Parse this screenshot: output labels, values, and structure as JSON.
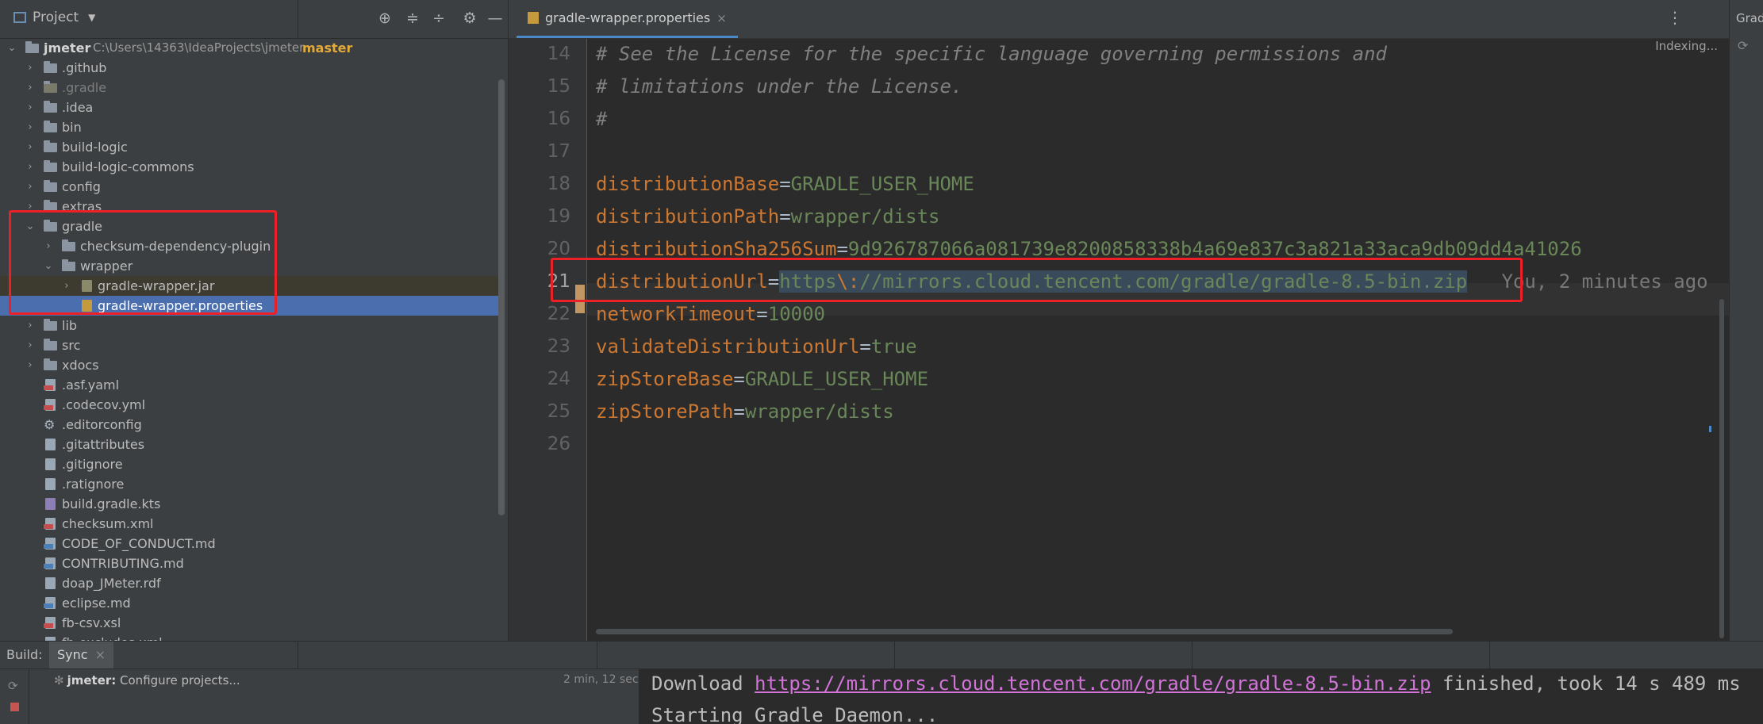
{
  "project_header": {
    "title": "Project"
  },
  "tree": {
    "root": {
      "name": "jmeter",
      "path": "C:\\Users\\14363\\IdeaProjects\\jmeter",
      "branch": "master"
    },
    "items": [
      {
        "label": ".github"
      },
      {
        "label": ".gradle"
      },
      {
        "label": ".idea"
      },
      {
        "label": "bin"
      },
      {
        "label": "build-logic"
      },
      {
        "label": "build-logic-commons"
      },
      {
        "label": "config"
      },
      {
        "label": "extras"
      },
      {
        "label": "gradle"
      },
      {
        "label": "checksum-dependency-plugin"
      },
      {
        "label": "wrapper"
      },
      {
        "label": "gradle-wrapper.jar"
      },
      {
        "label": "gradle-wrapper.properties"
      },
      {
        "label": "lib"
      },
      {
        "label": "src"
      },
      {
        "label": "xdocs"
      },
      {
        "label": ".asf.yaml"
      },
      {
        "label": ".codecov.yml"
      },
      {
        "label": ".editorconfig"
      },
      {
        "label": ".gitattributes"
      },
      {
        "label": ".gitignore"
      },
      {
        "label": ".ratignore"
      },
      {
        "label": "build.gradle.kts"
      },
      {
        "label": "checksum.xml"
      },
      {
        "label": "CODE_OF_CONDUCT.md"
      },
      {
        "label": "CONTRIBUTING.md"
      },
      {
        "label": "doap_JMeter.rdf"
      },
      {
        "label": "eclipse.md"
      },
      {
        "label": "fb-csv.xsl"
      },
      {
        "label": "fb-excludes.xml"
      }
    ]
  },
  "editor": {
    "tab_label": "gradle-wrapper.properties",
    "tab_close": "×",
    "status": "Indexing...",
    "line_numbers": [
      "14",
      "15",
      "16",
      "17",
      "18",
      "19",
      "20",
      "21",
      "22",
      "23",
      "24",
      "25",
      "26"
    ],
    "lines": {
      "l14": "# See the License for the specific language governing permissions and",
      "l15": "# limitations under the License.",
      "l16": "#",
      "l18_key": "distributionBase",
      "l18_val": "GRADLE_USER_HOME",
      "l19_key": "distributionPath",
      "l19_val": "wrapper/dists",
      "l20_key": "distributionSha256Sum",
      "l20_val": "9d926787066a081739e8200858338b4a69e837c3a821a33aca9db09dd4a41026",
      "l21_key": "distributionUrl",
      "l21_scheme": "https",
      "l21_escape": "\\:",
      "l21_rest": "//mirrors.cloud.tencent.com/gradle/gradle-8.5-bin.zip",
      "l21_blame": "You, 2 minutes ago",
      "l22_key": "networkTimeout",
      "l22_val": "10000",
      "l23_key": "validateDistributionUrl",
      "l23_val": "true",
      "l24_key": "zipStoreBase",
      "l24_val": "GRADLE_USER_HOME",
      "l25_key": "zipStorePath",
      "l25_val": "wrapper/dists"
    }
  },
  "right_strip": {
    "label": "Gradle"
  },
  "build": {
    "label": "Build:",
    "tab": "Sync",
    "tab_close": "×",
    "task_project": "jmeter:",
    "task_text": " Configure projects...",
    "time": "2 min, 12 sec",
    "console": {
      "line1_prefix": "Download ",
      "line1_link": "https://mirrors.cloud.tencent.com/gradle/gradle-8.5-bin.zip",
      "line1_suffix": " finished, took 14 s 489 ms",
      "line2": "Starting Gradle Daemon..."
    }
  },
  "colors": {
    "selection": "#4b6eaf",
    "accent": "#4a88c7",
    "highlight_box": "#ec2026",
    "branch": "#e2a93b"
  }
}
